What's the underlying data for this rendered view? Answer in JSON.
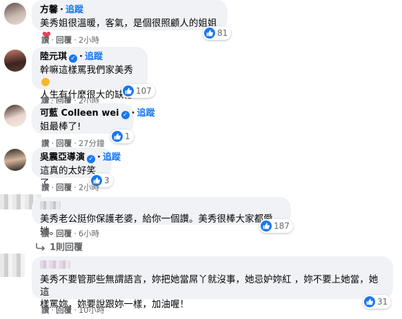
{
  "labels": {
    "follow": "追蹤",
    "like": "讚",
    "reply": "回覆",
    "separator": "·"
  },
  "colors": {
    "accent": "#1877f2",
    "bubble": "#f0f2f5",
    "meta": "#65676b",
    "heart": "#f33e58"
  },
  "comments": [
    {
      "name": "方馨",
      "verified": false,
      "text": [
        "美秀姐很溫暖，客氣，是個很照顧人的姐姐"
      ],
      "reaction_icons": [
        "like-icon",
        "heart-icon"
      ],
      "reactions": "81",
      "time": "2小時"
    },
    {
      "name": "陸元琪",
      "verified": true,
      "text": [
        "幹嘛這樣罵我們家美秀",
        "人生有什麼很大的缺憾嗎？"
      ],
      "text_emoji": "frown-emoji",
      "reaction_icons": [
        "like-icon"
      ],
      "reactions": "107",
      "time": "2小時"
    },
    {
      "name": "可藍 Colleen wei",
      "verified": true,
      "text": [
        "姐最棒了!"
      ],
      "reaction_icons": [
        "like-icon"
      ],
      "reactions": "1",
      "time": "27分鐘"
    },
    {
      "name": "吳震亞導演",
      "verified": true,
      "text": [
        "這真的太好笑了"
      ],
      "reaction_icons": [
        "like-icon"
      ],
      "reactions": "3",
      "time": "2小時"
    },
    {
      "name": "",
      "verified": false,
      "text": [
        "美秀老公挺你保護老婆，給你一個讚。美秀很棒大家都愛她。"
      ],
      "reaction_icons": [
        "like-icon"
      ],
      "reactions": "187",
      "time": "6小時",
      "replies": "1則回覆"
    },
    {
      "name": "",
      "verified": false,
      "text": [
        "美秀不要管那些無謂語言，妳把她當屌丫就沒事，她忌妒妳紅 ，妳不要上她當，她這",
        "樣罵妳，妳要說跟妳一樣，加油喔！"
      ],
      "reaction_icons": [
        "like-icon"
      ],
      "reactions": "31",
      "time": "10小時"
    }
  ]
}
